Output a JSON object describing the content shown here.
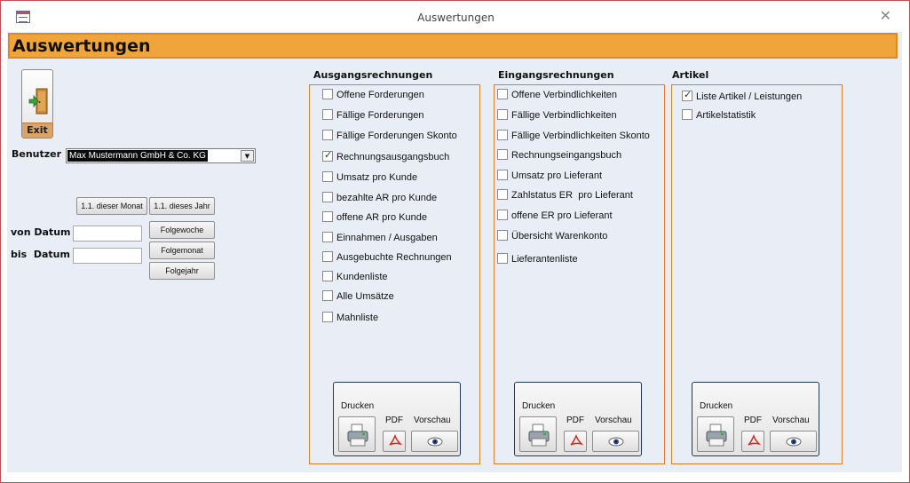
{
  "window": {
    "title": "Auswertungen"
  },
  "header": {
    "title": "Auswertungen"
  },
  "exit": {
    "label": "Exit"
  },
  "user": {
    "label": "Benutzer",
    "value": "Max Mustermann GmbH & Co. KG"
  },
  "dates": {
    "btn_month": "1.1. dieser Monat",
    "btn_year": "1.1. dieses Jahr",
    "from_label": "von Datum",
    "to_label": "bis  Datum",
    "from_value": "",
    "to_value": "",
    "btn_next_week": "Folgewoche",
    "btn_next_month": "Folgemonat",
    "btn_next_year": "Folgejahr"
  },
  "groups": {
    "ausgang": {
      "title": "Ausgangsrechnungen",
      "items": [
        {
          "label": "Offene Forderungen",
          "checked": false
        },
        {
          "label": "Fällige Forderungen",
          "checked": false
        },
        {
          "label": "Fällige Forderungen Skonto",
          "checked": false
        },
        {
          "label": "Rechnungsausgangsbuch",
          "checked": true
        },
        {
          "label": "Umsatz pro Kunde",
          "checked": false
        },
        {
          "label": "bezahlte AR pro Kunde",
          "checked": false
        },
        {
          "label": "offene AR pro Kunde",
          "checked": false
        },
        {
          "label": "Einnahmen / Ausgaben",
          "checked": false
        },
        {
          "label": "Ausgebuchte Rechnungen",
          "checked": false
        },
        {
          "label": "Kundenliste",
          "checked": false
        },
        {
          "label": "Alle Umsätze",
          "checked": false
        },
        {
          "label": "Mahnliste",
          "checked": false
        }
      ]
    },
    "eingang": {
      "title": "Eingangsrechnungen",
      "items": [
        {
          "label": "Offene Verbindlichkeiten",
          "checked": false
        },
        {
          "label": "Fällige Verbindlichkeiten",
          "checked": false
        },
        {
          "label": "Fällige Verbindlichkeiten Skonto",
          "checked": false
        },
        {
          "label": "Rechnungseingangsbuch",
          "checked": false
        },
        {
          "label": "Umsatz pro Lieferant",
          "checked": false
        },
        {
          "label": "Zahlstatus ER  pro Lieferant",
          "checked": false
        },
        {
          "label": "offene ER pro Lieferant",
          "checked": false
        },
        {
          "label": "Übersicht Warenkonto",
          "checked": false
        },
        {
          "label": "Lieferantenliste",
          "checked": false
        }
      ]
    },
    "artikel": {
      "title": "Artikel",
      "items": [
        {
          "label": "Liste Artikel / Leistungen",
          "checked": true
        },
        {
          "label": "Artikelstatistik",
          "checked": false
        }
      ]
    }
  },
  "print_panel": {
    "print_label": "Drucken",
    "pdf_label": "PDF",
    "preview_label": "Vorschau"
  },
  "colors": {
    "header_bg": "#f0a43c",
    "group_border": "#e07b2c",
    "form_bg": "#e9eef6",
    "window_border": "#c0504d"
  },
  "icons": {
    "close": "close-icon",
    "exit": "exit-door-icon",
    "printer": "printer-icon",
    "pdf": "pdf-icon",
    "preview": "eye-icon",
    "dropdown": "chevron-down-icon"
  }
}
